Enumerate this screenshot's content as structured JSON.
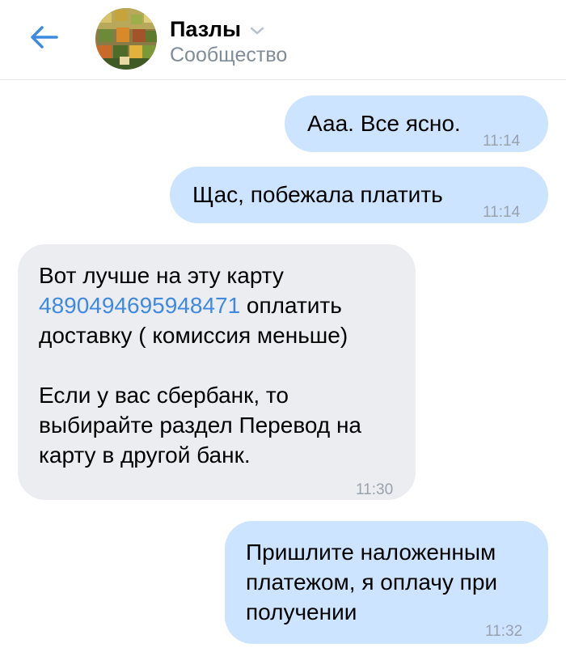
{
  "header": {
    "title": "Пазлы",
    "subtitle": "Сообщество"
  },
  "messages": [
    {
      "text": "Ааа. Все ясно.",
      "time": "11:14"
    },
    {
      "text": "Щас, побежала платить",
      "time": "11:14"
    },
    {
      "line1": "Вот лучше на эту карту",
      "card": "4890494695948471",
      "line2_rest": " оплатить",
      "line3": "доставку ( комиссия меньше)",
      "line4": "Если у вас сбербанк, то",
      "line5": "выбирайте раздел Перевод на",
      "line6": "карту в другой банк.",
      "time": "11:30"
    },
    {
      "line1": "Пришлите наложенным",
      "line2": "платежом, я оплачу при",
      "line3": "получении",
      "time": "11:32"
    }
  ],
  "colors": {
    "outgoing_bubble": "#cce4ff",
    "incoming_bubble": "#ebedf0",
    "link": "#3f8ae0",
    "accent": "#3f8ae0"
  }
}
